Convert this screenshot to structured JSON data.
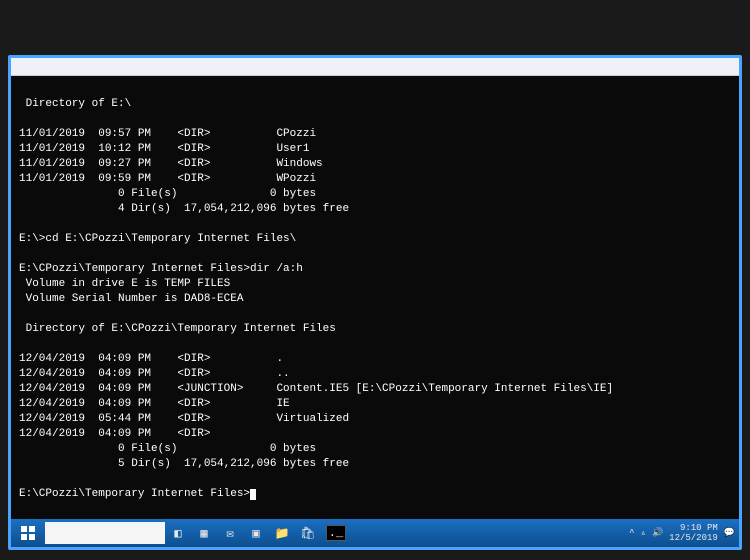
{
  "terminal": {
    "header1": " Directory of E:\\",
    "listing1": [
      "11/01/2019  09:57 PM    <DIR>          CPozzi",
      "11/01/2019  10:12 PM    <DIR>          User1",
      "11/01/2019  09:27 PM    <DIR>          Windows",
      "11/01/2019  09:59 PM    <DIR>          WPozzi"
    ],
    "summary1a": "               0 File(s)              0 bytes",
    "summary1b": "               4 Dir(s)  17,054,212,096 bytes free",
    "cmd1": "E:\\>cd E:\\CPozzi\\Temporary Internet Files\\",
    "cmd2": "E:\\CPozzi\\Temporary Internet Files>dir /a:h",
    "volLabel": " Volume in drive E is TEMP FILES",
    "volSerial": " Volume Serial Number is DAD8-ECEA",
    "header2": " Directory of E:\\CPozzi\\Temporary Internet Files",
    "listing2": [
      "12/04/2019  04:09 PM    <DIR>          .",
      "12/04/2019  04:09 PM    <DIR>          ..",
      "12/04/2019  04:09 PM    <JUNCTION>     Content.IE5 [E:\\CPozzi\\Temporary Internet Files\\IE]",
      "12/04/2019  04:09 PM    <DIR>          IE",
      "12/04/2019  05:44 PM    <DIR>          Virtualized",
      "12/04/2019  04:09 PM    <DIR>"
    ],
    "summary2a": "               0 File(s)              0 bytes",
    "summary2b": "               5 Dir(s)  17,054,212,096 bytes free",
    "prompt": "E:\\CPozzi\\Temporary Internet Files>"
  },
  "tray": {
    "time": "9:10 PM",
    "date": "12/5/2019"
  }
}
